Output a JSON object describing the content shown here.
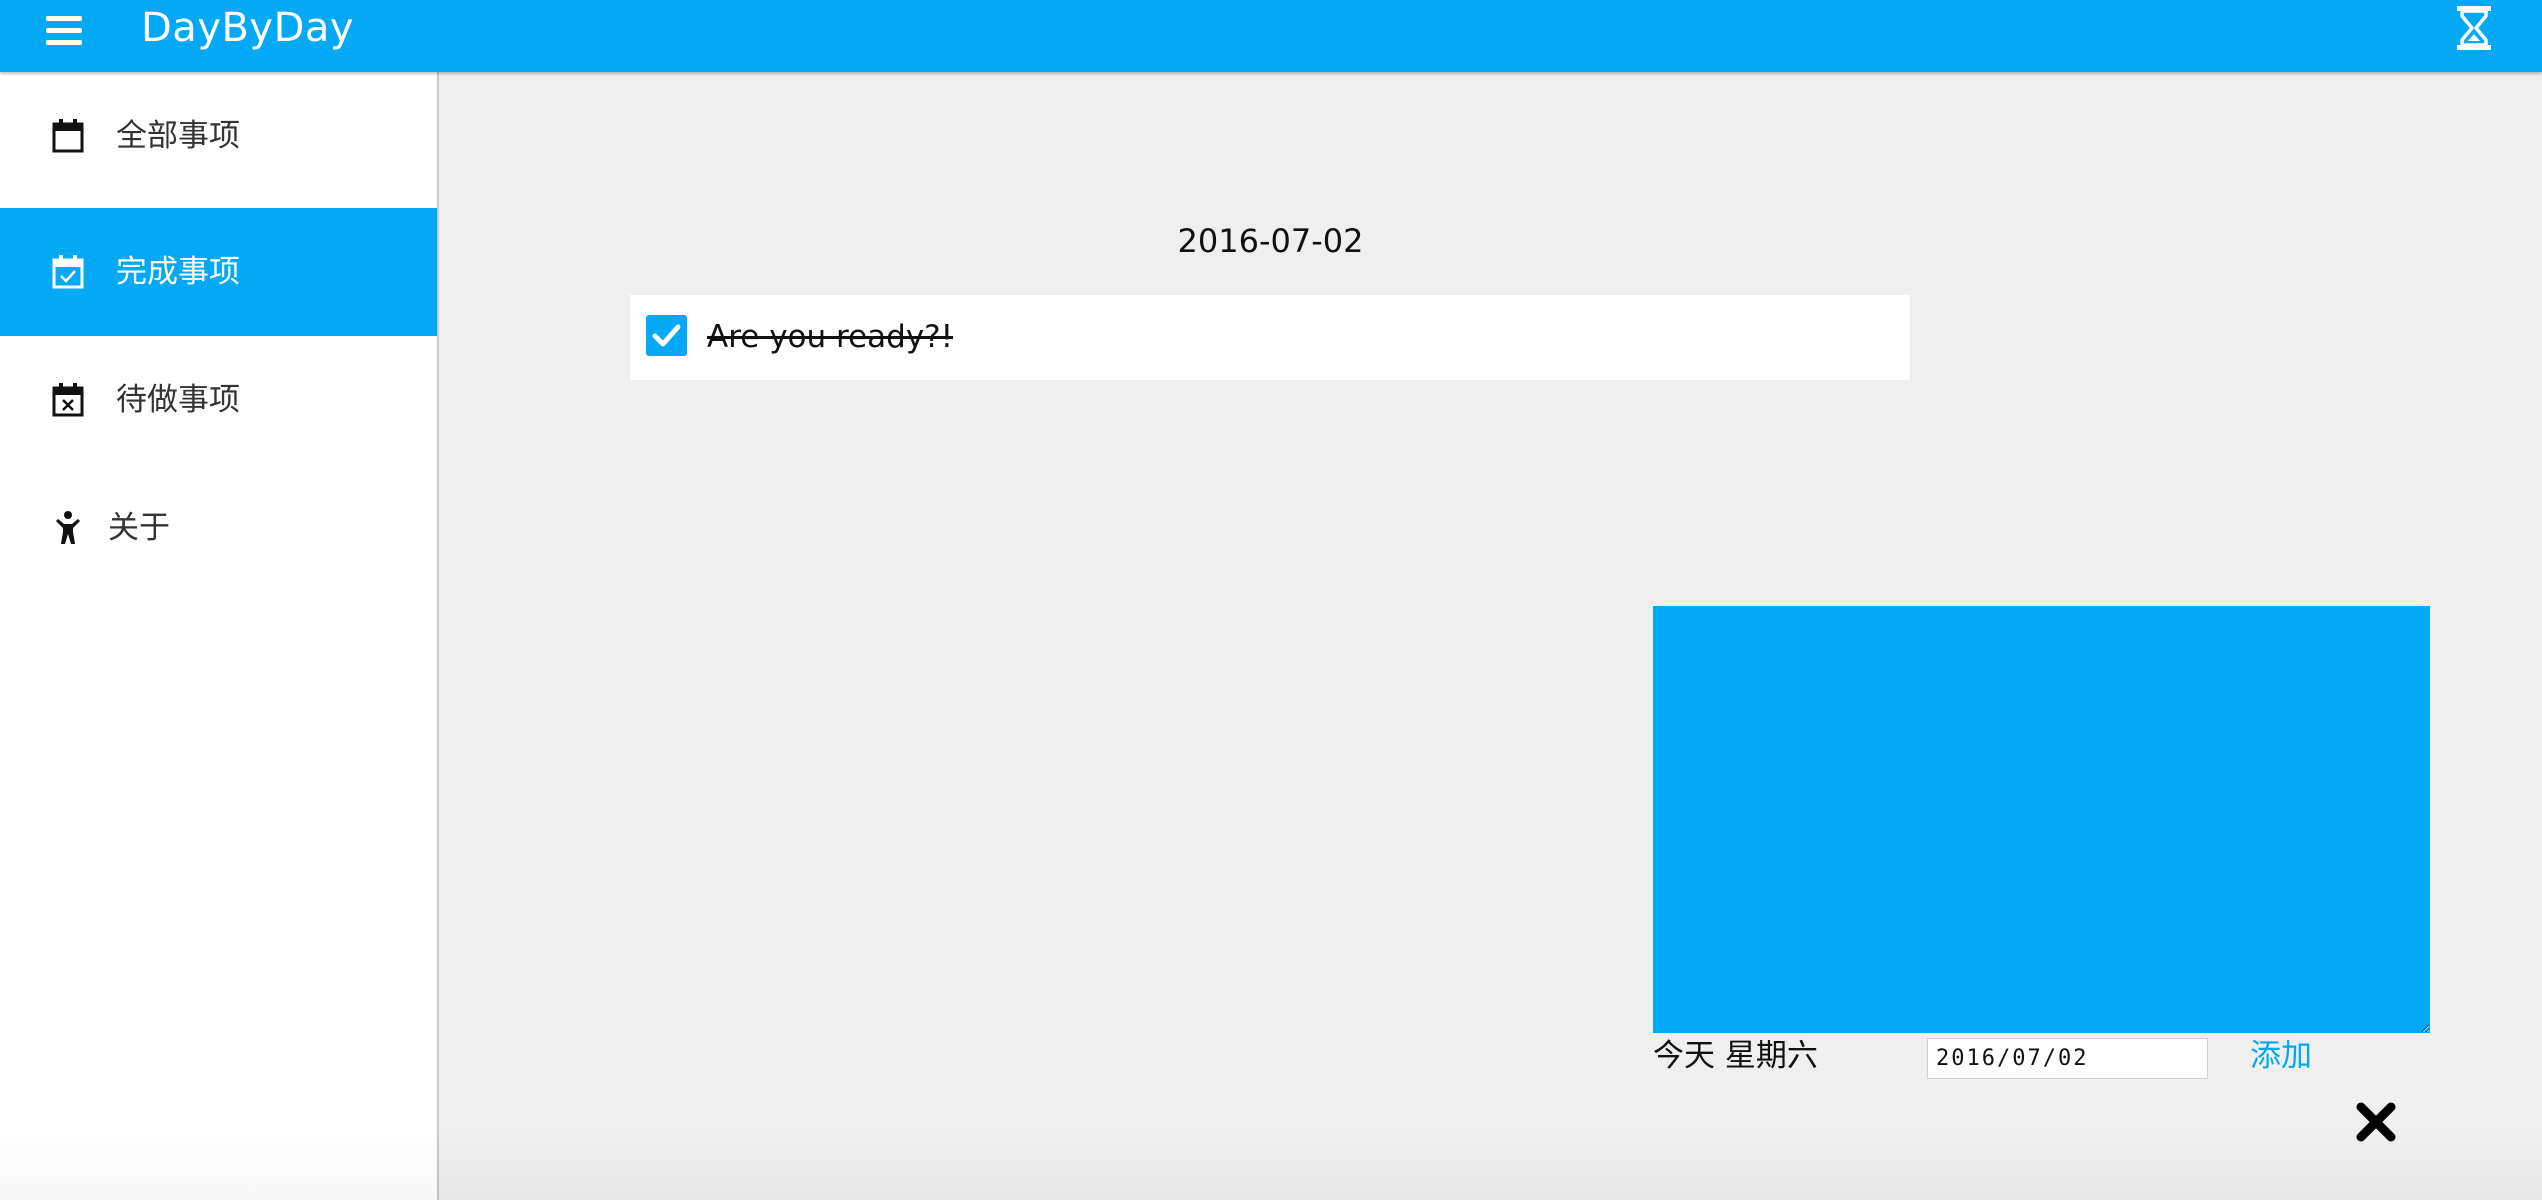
{
  "app": {
    "title": "DayByDay"
  },
  "header": {
    "menu_icon": "hamburger-icon",
    "timer_icon": "hourglass-icon"
  },
  "sidebar": {
    "items": [
      {
        "label": "全部事项",
        "icon": "calendar-icon",
        "active": false
      },
      {
        "label": "完成事项",
        "icon": "calendar-check-icon",
        "active": true
      },
      {
        "label": "待做事项",
        "icon": "calendar-x-icon",
        "active": false
      },
      {
        "label": "关于",
        "icon": "person-icon",
        "active": false
      }
    ]
  },
  "main": {
    "date_heading": "2016-07-02",
    "todos": [
      {
        "text": "Are you ready?!",
        "done": true
      }
    ]
  },
  "add_panel": {
    "note_value": "",
    "day_label": "今天 星期六",
    "date_value": "2016/07/02",
    "add_label": "添加",
    "close_icon": "close-icon"
  },
  "colors": {
    "accent": "#03a9f4",
    "background": "#efefef",
    "sidebar": "#ffffff"
  }
}
